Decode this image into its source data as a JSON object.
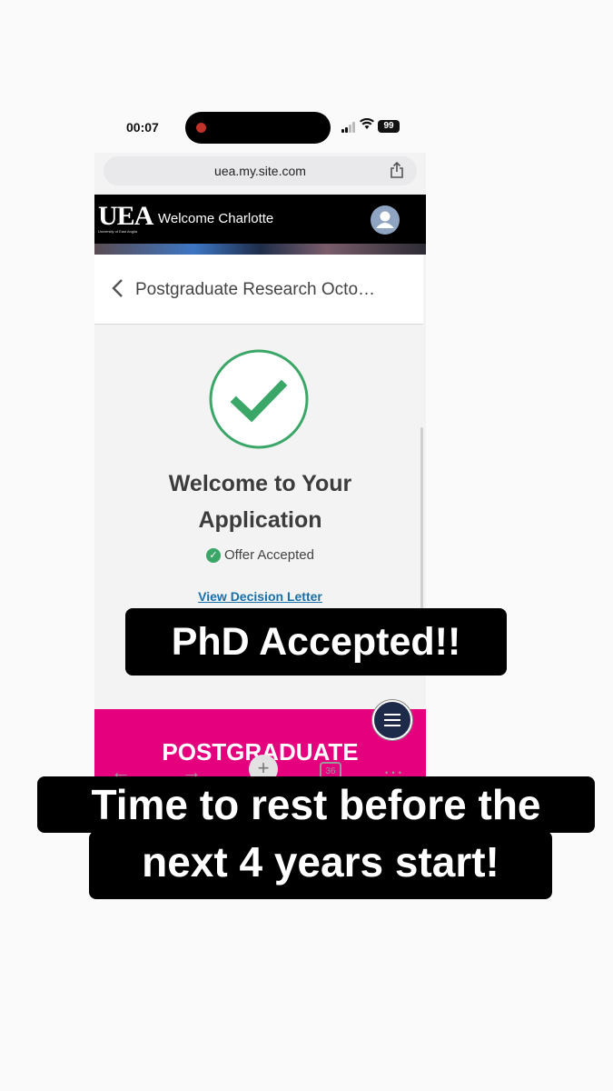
{
  "status_bar": {
    "time": "00:07",
    "battery": "99"
  },
  "browser": {
    "url": "uea.my.site.com"
  },
  "header": {
    "logo_text": "UEA",
    "logo_subtext": "University of East Anglia",
    "welcome": "Welcome Charlotte"
  },
  "page": {
    "breadcrumb": "Postgraduate Research Octo…",
    "title_line1": "Welcome to Your",
    "title_line2": "Application",
    "status": "Offer Accepted",
    "decision_link": "View Decision Letter",
    "pink_banner": "POSTGRADUATE"
  },
  "toolbar": {
    "tab_count": "36"
  },
  "captions": {
    "top": "PhD Accepted!!",
    "bottom_line1": "Time to rest before the",
    "bottom_line2": "next 4 years start!"
  },
  "colors": {
    "accent_green": "#3aa667",
    "brand_pink": "#e5007e",
    "link_blue": "#1a6fa8"
  }
}
